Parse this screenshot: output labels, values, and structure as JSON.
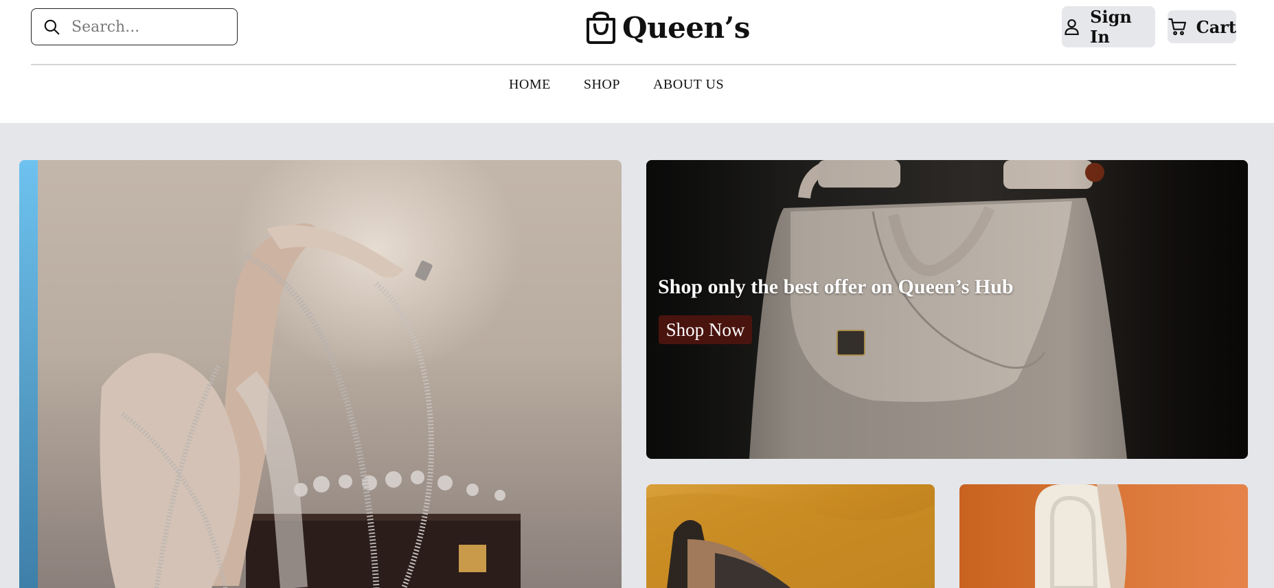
{
  "header": {
    "search": {
      "placeholder": "Search..."
    },
    "logo": {
      "text": "Queen’s"
    },
    "sign_in_label": "Sign In",
    "cart_label": "Cart"
  },
  "nav": {
    "items": [
      {
        "label": "HOME"
      },
      {
        "label": "SHOP"
      },
      {
        "label": "ABOUT US"
      }
    ]
  },
  "hero": {
    "headline": "Shop only the best offer on Queen’s Hub",
    "cta_label": "Shop Now"
  },
  "colors": {
    "content_background": "#e5e6ea",
    "button_background": "#e6e7ea",
    "cta_background": "#4a140e"
  },
  "icons": {
    "search": "search-icon",
    "logo": "shopping-bag-icon",
    "sign_in": "user-icon",
    "cart": "cart-icon"
  }
}
